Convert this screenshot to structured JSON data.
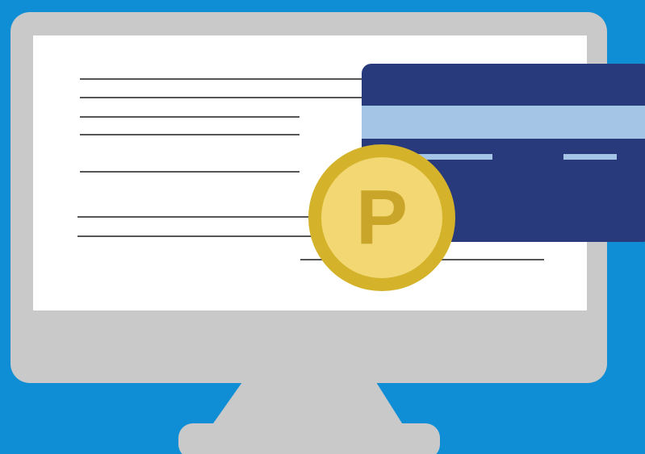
{
  "illustration": {
    "subject": "computer-monitor-with-payment-card-and-coin",
    "coin_letter": "P",
    "colors": {
      "background": "#0f8ed6",
      "monitor": "#c9c9c9",
      "screen": "#ffffff",
      "card": "#283a7c",
      "card_stripe": "#a5c5e6",
      "coin_rim": "#d4b32b",
      "coin_face": "#f2d773",
      "text_lines": "#555555"
    },
    "icons": [
      "monitor-icon",
      "credit-card-icon",
      "coin-icon"
    ]
  }
}
